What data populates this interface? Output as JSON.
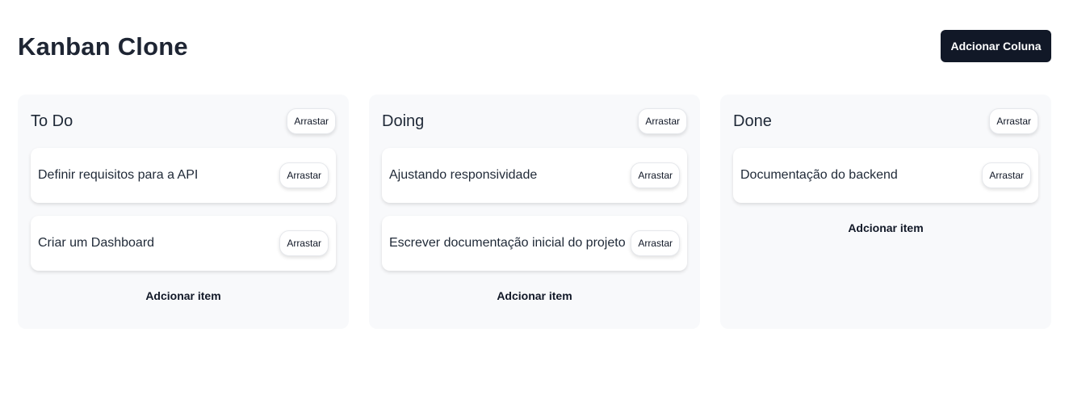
{
  "header": {
    "title": "Kanban Clone",
    "add_column_label": "Adcionar Coluna"
  },
  "columns": [
    {
      "title": "To Do",
      "drag_label": "Arrastar",
      "items": [
        {
          "text": "Definir requisitos para a API",
          "drag_label": "Arrastar"
        },
        {
          "text": "Criar um Dashboard",
          "drag_label": "Arrastar"
        }
      ],
      "add_item_label": "Adcionar item"
    },
    {
      "title": "Doing",
      "drag_label": "Arrastar",
      "items": [
        {
          "text": "Ajustando responsividade",
          "drag_label": "Arrastar"
        },
        {
          "text": "Escrever documentação inicial do projeto",
          "drag_label": "Arrastar"
        }
      ],
      "add_item_label": "Adcionar item"
    },
    {
      "title": "Done",
      "drag_label": "Arrastar",
      "items": [
        {
          "text": "Documentação do backend",
          "drag_label": "Arrastar"
        }
      ],
      "add_item_label": "Adcionar item"
    }
  ]
}
